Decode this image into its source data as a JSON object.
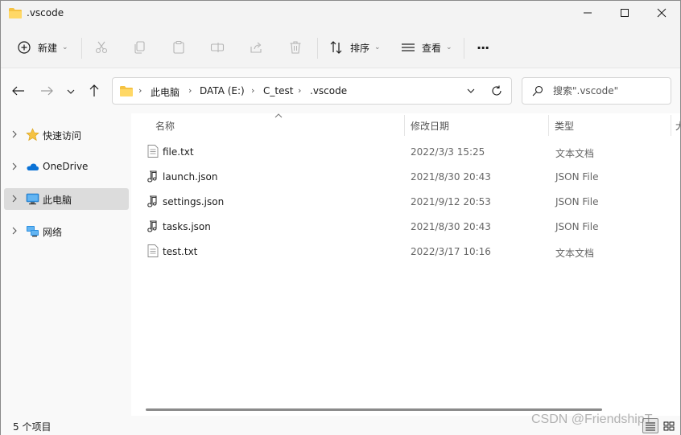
{
  "window": {
    "title": ".vscode",
    "colors": {
      "folder": "#f5c242",
      "accent": "#0067c0",
      "selected": "#dcdcdc"
    }
  },
  "toolbar": {
    "new_label": "新建",
    "sort_label": "排序",
    "view_label": "查看",
    "more_label": "···",
    "icons": [
      "cut-icon",
      "copy-icon",
      "paste-icon",
      "rename-icon",
      "share-icon",
      "delete-icon"
    ]
  },
  "address": {
    "breadcrumbs": [
      "此电脑",
      "DATA (E:)",
      "C_test",
      ".vscode"
    ]
  },
  "search": {
    "placeholder": "搜索\".vscode\""
  },
  "sidebar": {
    "items": [
      {
        "label": "快速访问",
        "icon": "star-icon"
      },
      {
        "label": "OneDrive",
        "icon": "cloud-icon"
      },
      {
        "label": "此电脑",
        "icon": "computer-icon",
        "selected": true
      },
      {
        "label": "网络",
        "icon": "network-icon"
      }
    ]
  },
  "columns": {
    "name": "名称",
    "modified": "修改日期",
    "type": "类型",
    "size_partial": "大"
  },
  "files": [
    {
      "name": "file.txt",
      "modified": "2022/3/3 15:25",
      "type": "文本文档",
      "icon": "text-file-icon"
    },
    {
      "name": "launch.json",
      "modified": "2021/8/30 20:43",
      "type": "JSON File",
      "icon": "json-file-icon"
    },
    {
      "name": "settings.json",
      "modified": "2021/9/12 20:53",
      "type": "JSON File",
      "icon": "json-file-icon"
    },
    {
      "name": "tasks.json",
      "modified": "2021/8/30 20:43",
      "type": "JSON File",
      "icon": "json-file-icon"
    },
    {
      "name": "test.txt",
      "modified": "2022/3/17 10:16",
      "type": "文本文档",
      "icon": "text-file-icon"
    }
  ],
  "status": {
    "count_text": "5 个项目"
  },
  "watermark": "CSDN @FriendshipT"
}
